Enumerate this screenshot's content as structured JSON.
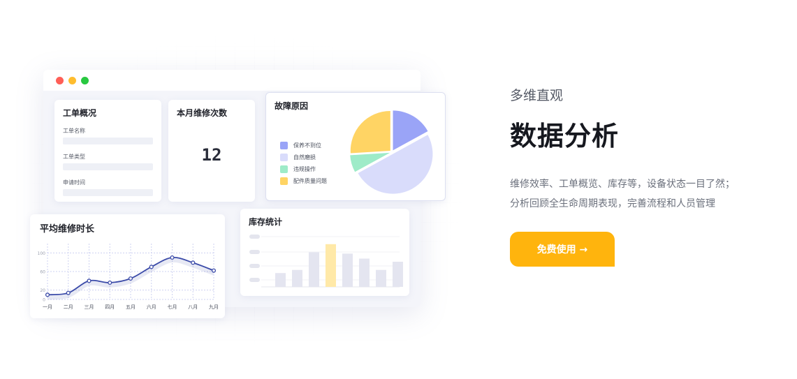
{
  "window": {
    "dots": [
      {
        "name": "close-dot",
        "color": "#ff5f57"
      },
      {
        "name": "minimize-dot",
        "color": "#ffbd2e"
      },
      {
        "name": "maximize-dot",
        "color": "#28c840"
      }
    ]
  },
  "overview": {
    "title": "工单概况",
    "fields": [
      "工单名称",
      "工单类型",
      "申请时间"
    ]
  },
  "monthly": {
    "title": "本月维修次数",
    "value": "12"
  },
  "fault": {
    "title": "故障原因",
    "legend": [
      {
        "label": "保养不到位",
        "color": "#9aa4f7"
      },
      {
        "label": "自然磨损",
        "color": "#d9dcfb"
      },
      {
        "label": "违规操作",
        "color": "#9eebc8"
      },
      {
        "label": "配件质量问题",
        "color": "#ffd464"
      }
    ]
  },
  "inventory": {
    "title": "库存统计"
  },
  "avg_repair": {
    "title": "平均维修时长"
  },
  "chart_data": [
    {
      "type": "pie",
      "title": "故障原因",
      "labels": [
        "保养不到位",
        "自然磨损",
        "违规操作",
        "配件质量问题"
      ],
      "values": [
        17,
        50,
        7,
        26
      ],
      "colors": [
        "#9aa4f7",
        "#d9dcfb",
        "#9eebc8",
        "#ffd464"
      ]
    },
    {
      "type": "bar",
      "title": "库存统计",
      "values": [
        22,
        27,
        55,
        68,
        53,
        45,
        27,
        40
      ],
      "highlight_index": 3,
      "colors": {
        "normal": "#e4e5f0",
        "highlight": "#ffe9a8"
      },
      "ylim": [
        0,
        80
      ]
    },
    {
      "type": "line",
      "title": "平均维修时长",
      "categories": [
        "一月",
        "二月",
        "三月",
        "四月",
        "五月",
        "六月",
        "七月",
        "八月",
        "九月"
      ],
      "values": [
        10,
        14,
        40,
        36,
        45,
        70,
        90,
        79,
        62
      ],
      "yticks": [
        0,
        20,
        60,
        100
      ],
      "ylim": [
        0,
        120
      ],
      "color": "#3a4aa8"
    }
  ],
  "hero": {
    "subtitle": "多维直观",
    "title": "数据分析",
    "desc_line1": "维修效率、工单概览、库存等，设备状态一目了然；",
    "desc_line2": "分析回顾全生命周期表现，完善流程和人员管理",
    "cta": "免费使用 →"
  }
}
